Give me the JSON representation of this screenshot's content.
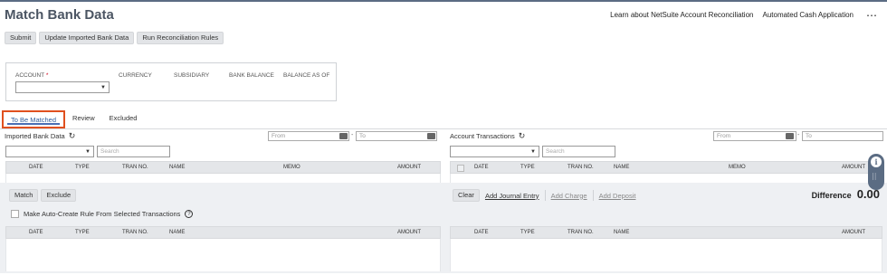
{
  "page": {
    "title": "Match Bank Data"
  },
  "top_links": {
    "learn": "Learn about NetSuite Account Reconciliation",
    "automated": "Automated Cash Application",
    "more": "⋯"
  },
  "toolbar": {
    "submit": "Submit",
    "update": "Update Imported Bank Data",
    "run_rules": "Run Reconciliation Rules"
  },
  "filters": {
    "account": "ACCOUNT",
    "account_required": "*",
    "currency": "CURRENCY",
    "subsidiary": "SUBSIDIARY",
    "bank_balance": "BANK BALANCE",
    "balance_as_of": "BALANCE AS OF"
  },
  "tabs": [
    "To Be Matched",
    "Review",
    "Excluded"
  ],
  "imported": {
    "title": "Imported Bank Data",
    "from_placeholder": "From",
    "to_placeholder": "To",
    "search_placeholder": "Search",
    "columns": [
      "DATE",
      "TYPE",
      "TRAN NO.",
      "NAME",
      "MEMO",
      "AMOUNT"
    ]
  },
  "account_tx": {
    "title": "Account Transactions",
    "from_placeholder": "From",
    "to_placeholder": "To",
    "search_placeholder": "Search",
    "columns": [
      "DATE",
      "TYPE",
      "TRAN NO.",
      "NAME",
      "MEMO",
      "AMOUNT"
    ]
  },
  "actions": {
    "match": "Match",
    "exclude": "Exclude",
    "auto_create": "Make Auto-Create Rule From Selected Transactions",
    "clear": "Clear",
    "add_journal": "Add Journal Entry",
    "add_charge": "Add Charge",
    "add_deposit": "Add Deposit"
  },
  "difference": {
    "label": "Difference",
    "value": "0.00"
  },
  "bottom_left_columns": [
    "DATE",
    "TYPE",
    "TRAN NO.",
    "NAME",
    "AMOUNT"
  ],
  "bottom_right_columns": [
    "DATE",
    "TYPE",
    "TRAN NO.",
    "NAME",
    "AMOUNT"
  ],
  "colors": {
    "active_tab_outline": "#e0501f",
    "active_tab_text": "#2e5e9d",
    "top_bar": "#5b6c83"
  }
}
